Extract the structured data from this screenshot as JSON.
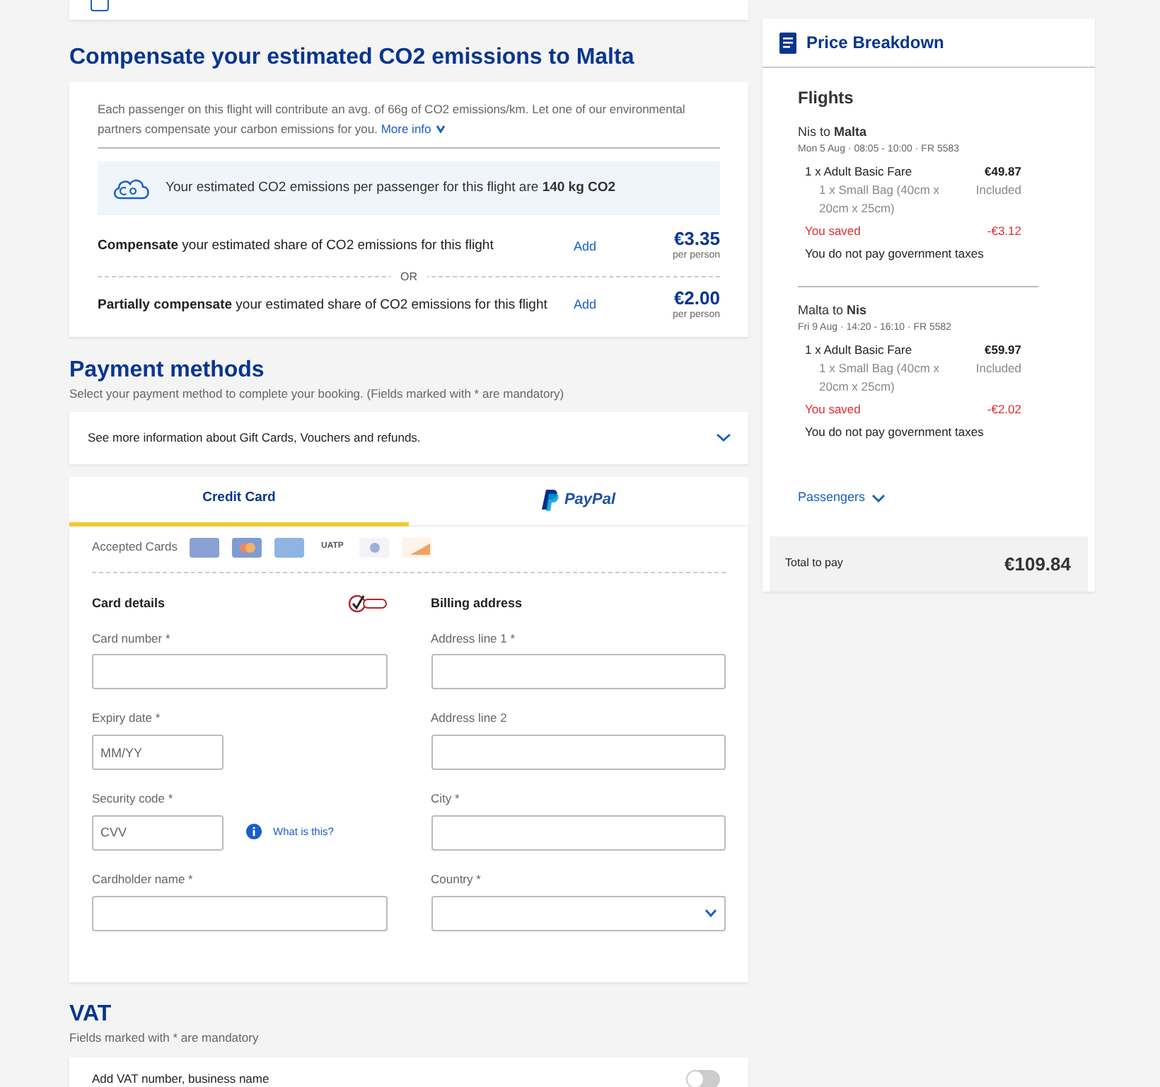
{
  "sms_option": {
    "checked": false
  },
  "co2": {
    "title": "Compensate your estimated CO2 emissions to Malta",
    "intro": "Each passenger on this flight will contribute an avg. of 66g of CO2 emissions/km. Let one of our environmental partners compensate your carbon emissions for you.",
    "more_info": "More info",
    "estimate": "Your estimated CO2 emissions per passenger for this flight are **140 kg CO2**",
    "separator": "OR",
    "options": [
      {
        "text": "**Compensate** your estimated share of CO2 emissions for this flight",
        "action": "Add",
        "price": "€3.35",
        "unit": "per person"
      },
      {
        "text": "**Partially compensate** your estimated share of CO2 emissions for this flight",
        "action": "Add",
        "price": "€2.00",
        "unit": "per person"
      }
    ]
  },
  "payment": {
    "title": "Payment methods",
    "subtitle": "Select your payment method to complete your booking.   (Fields marked with * are mandatory)",
    "info": "See more information about Gift Cards, Vouchers and refunds.",
    "tabs": [
      {
        "label": "Credit Card",
        "kind": "text",
        "selected": true
      },
      {
        "label": "PayPal",
        "kind": "paypal",
        "selected": false
      }
    ],
    "accepted_label": "Accepted Cards",
    "cards": [
      {
        "kind": "visa"
      },
      {
        "kind": "mastercard"
      },
      {
        "kind": "amex"
      },
      {
        "kind": "uatp",
        "label": "UATP"
      },
      {
        "kind": "diners"
      },
      {
        "kind": "discover"
      }
    ],
    "card_details": {
      "title": "Card details",
      "fields": [
        {
          "label": "Card number *",
          "kind": "text"
        },
        {
          "label": "Expiry date *",
          "kind": "short",
          "placeholder": "MM/YY"
        },
        {
          "label": "Security code *",
          "kind": "short",
          "placeholder": "CVV",
          "help": "What is this?"
        },
        {
          "label": "Cardholder name *",
          "kind": "text"
        }
      ]
    },
    "billing": {
      "title": "Billing address",
      "fields": [
        {
          "label": "Address line 1 *",
          "kind": "text"
        },
        {
          "label": "Address line 2",
          "kind": "text"
        },
        {
          "label": "City *",
          "kind": "text"
        },
        {
          "label": "Country *",
          "kind": "select"
        }
      ]
    }
  },
  "vat": {
    "title": "VAT",
    "subtitle": "Fields marked with * are mandatory",
    "option": "Add VAT number, business name",
    "on": false
  },
  "price_breakdown": {
    "title": "Price Breakdown",
    "section": "Flights",
    "legs": [
      {
        "route": "Nis to **Malta**",
        "details": "Mon 5 Aug  ·  08:05 - 10:00  ·  FR 5583",
        "lines": [
          {
            "kind": "fare",
            "label": "1 x Adult Basic Fare",
            "amount": "€49.87"
          },
          {
            "kind": "extra",
            "label": "1 x Small Bag (40cm x 20cm x 25cm)",
            "amount": "Included"
          },
          {
            "kind": "saving",
            "label": "You saved",
            "amount": "-€3.12"
          },
          {
            "kind": "note",
            "label": "You do not pay government taxes"
          }
        ]
      },
      {
        "route": "Malta to **Nis**",
        "details": "Fri 9 Aug  ·  14:20 - 16:10  ·  FR 5582",
        "lines": [
          {
            "kind": "fare",
            "label": "1 x Adult Basic Fare",
            "amount": "€59.97"
          },
          {
            "kind": "extra",
            "label": "1 x Small Bag (40cm x 20cm x 25cm)",
            "amount": "Included"
          },
          {
            "kind": "saving",
            "label": "You saved",
            "amount": "-€2.02"
          },
          {
            "kind": "note",
            "label": "You do not pay government taxes"
          }
        ]
      }
    ],
    "passengers": "Passengers",
    "total_label": "Total to pay",
    "total": "€109.84"
  }
}
